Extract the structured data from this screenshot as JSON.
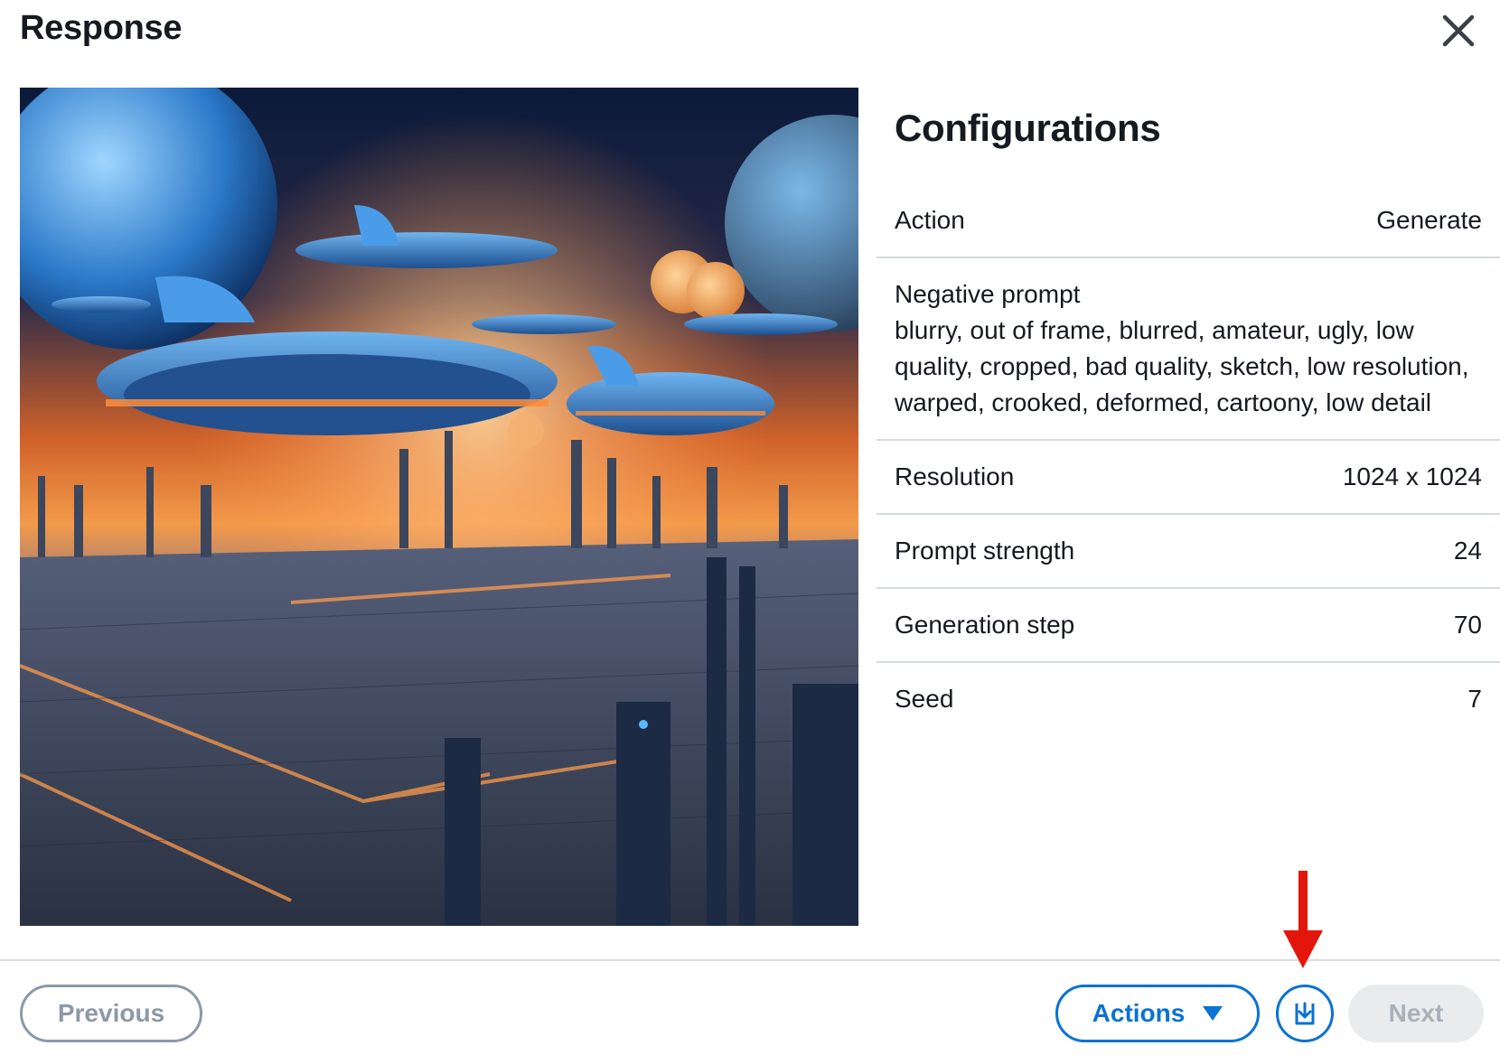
{
  "modal": {
    "title": "Response"
  },
  "configurations": {
    "title": "Configurations",
    "action": {
      "label": "Action",
      "value": "Generate"
    },
    "negative_prompt": {
      "label": "Negative prompt",
      "value": "blurry, out of frame, blurred, amateur, ugly, low quality, cropped, bad quality, sketch, low resolution, warped, crooked, deformed, cartoony, low detail"
    },
    "resolution": {
      "label": "Resolution",
      "value": "1024 x 1024"
    },
    "prompt_strength": {
      "label": "Prompt strength",
      "value": "24"
    },
    "generation_step": {
      "label": "Generation step",
      "value": "70"
    },
    "seed": {
      "label": "Seed",
      "value": "7"
    }
  },
  "footer": {
    "previous_label": "Previous",
    "actions_label": "Actions",
    "next_label": "Next"
  },
  "icons": {
    "close": "close-icon",
    "caret": "caret-down-icon",
    "download": "download-icon",
    "annotation": "red-arrow-icon"
  },
  "colors": {
    "primary": "#0972d3",
    "disabled_text": "#a8b1ba",
    "disabled_bg": "#e9ebed",
    "divider": "#d5dbdb",
    "annotation_red": "#e3160b"
  }
}
